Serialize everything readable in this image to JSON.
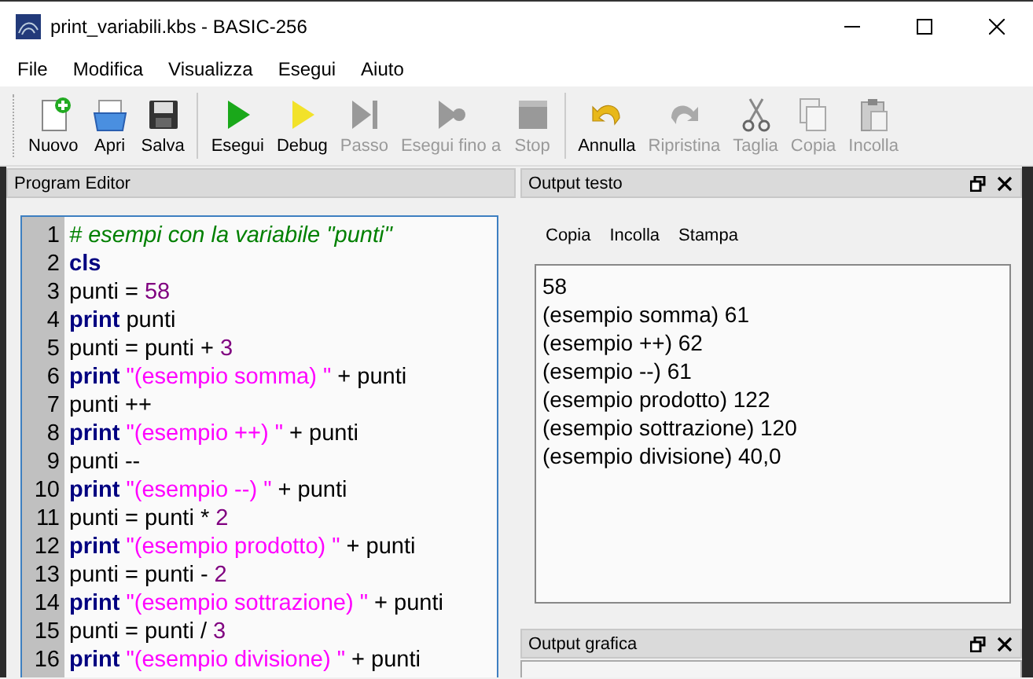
{
  "window": {
    "title": "print_variabili.kbs - BASIC-256"
  },
  "menu": [
    "File",
    "Modifica",
    "Visualizza",
    "Esegui",
    "Aiuto"
  ],
  "toolbar": [
    [
      {
        "label": "Nuovo",
        "kind": "new",
        "disabled": false
      },
      {
        "label": "Apri",
        "kind": "open",
        "disabled": false
      },
      {
        "label": "Salva",
        "kind": "save",
        "disabled": false
      }
    ],
    [
      {
        "label": "Esegui",
        "kind": "run",
        "disabled": false
      },
      {
        "label": "Debug",
        "kind": "debug",
        "disabled": false
      },
      {
        "label": "Passo",
        "kind": "step",
        "disabled": true
      },
      {
        "label": "Esegui fino a",
        "kind": "runto",
        "disabled": true
      },
      {
        "label": "Stop",
        "kind": "stop",
        "disabled": true
      }
    ],
    [
      {
        "label": "Annulla",
        "kind": "undo",
        "disabled": false
      },
      {
        "label": "Ripristina",
        "kind": "redo",
        "disabled": true
      },
      {
        "label": "Taglia",
        "kind": "cut",
        "disabled": true
      },
      {
        "label": "Copia",
        "kind": "copy",
        "disabled": true
      },
      {
        "label": "Incolla",
        "kind": "paste",
        "disabled": true
      }
    ]
  ],
  "editor": {
    "title": "Program Editor",
    "lines": [
      {
        "number": "1",
        "tokens": [
          {
            "kind": "comment",
            "text": "# esempi con la variabile \"punti\""
          }
        ]
      },
      {
        "number": "2",
        "tokens": [
          {
            "kind": "keyword",
            "text": "cls"
          }
        ]
      },
      {
        "number": "3",
        "tokens": [
          {
            "kind": "plain",
            "text": "punti = "
          },
          {
            "kind": "number",
            "text": "58"
          }
        ]
      },
      {
        "number": "4",
        "tokens": [
          {
            "kind": "keyword",
            "text": "print"
          },
          {
            "kind": "plain",
            "text": " punti"
          }
        ]
      },
      {
        "number": "5",
        "tokens": [
          {
            "kind": "plain",
            "text": "punti = punti + "
          },
          {
            "kind": "number",
            "text": "3"
          }
        ]
      },
      {
        "number": "6",
        "tokens": [
          {
            "kind": "keyword",
            "text": "print"
          },
          {
            "kind": "string",
            "text": " \"(esempio somma) \""
          },
          {
            "kind": "plain",
            "text": " + punti"
          }
        ]
      },
      {
        "number": "7",
        "tokens": [
          {
            "kind": "plain",
            "text": "punti ++"
          }
        ]
      },
      {
        "number": "8",
        "tokens": [
          {
            "kind": "keyword",
            "text": "print"
          },
          {
            "kind": "string",
            "text": " \"(esempio ++) \""
          },
          {
            "kind": "plain",
            "text": " + punti"
          }
        ]
      },
      {
        "number": "9",
        "tokens": [
          {
            "kind": "plain",
            "text": "punti --"
          }
        ]
      },
      {
        "number": "10",
        "tokens": [
          {
            "kind": "keyword",
            "text": "print"
          },
          {
            "kind": "string",
            "text": " \"(esempio --) \""
          },
          {
            "kind": "plain",
            "text": " + punti"
          }
        ]
      },
      {
        "number": "11",
        "tokens": [
          {
            "kind": "plain",
            "text": "punti = punti * "
          },
          {
            "kind": "number",
            "text": "2"
          }
        ]
      },
      {
        "number": "12",
        "tokens": [
          {
            "kind": "keyword",
            "text": "print"
          },
          {
            "kind": "string",
            "text": " \"(esempio prodotto) \""
          },
          {
            "kind": "plain",
            "text": " + punti"
          }
        ]
      },
      {
        "number": "13",
        "tokens": [
          {
            "kind": "plain",
            "text": "punti = punti - "
          },
          {
            "kind": "number",
            "text": "2"
          }
        ]
      },
      {
        "number": "14",
        "tokens": [
          {
            "kind": "keyword",
            "text": "print"
          },
          {
            "kind": "string",
            "text": " \"(esempio sottrazione) \""
          },
          {
            "kind": "plain",
            "text": " + punti"
          }
        ]
      },
      {
        "number": "15",
        "tokens": [
          {
            "kind": "plain",
            "text": "punti = punti / "
          },
          {
            "kind": "number",
            "text": "3"
          }
        ]
      },
      {
        "number": "16",
        "tokens": [
          {
            "kind": "keyword",
            "text": "print"
          },
          {
            "kind": "string",
            "text": " \"(esempio divisione) \""
          },
          {
            "kind": "plain",
            "text": " + punti"
          }
        ]
      }
    ]
  },
  "text_output": {
    "title": "Output testo",
    "actions": [
      "Copia",
      "Incolla",
      "Stampa"
    ],
    "lines": [
      "58",
      "(esempio somma) 61",
      "(esempio ++) 62",
      "(esempio --) 61",
      "(esempio prodotto) 122",
      "(esempio sottrazione) 120",
      "(esempio divisione) 40,0"
    ]
  },
  "graphic_output": {
    "title": "Output grafica"
  }
}
